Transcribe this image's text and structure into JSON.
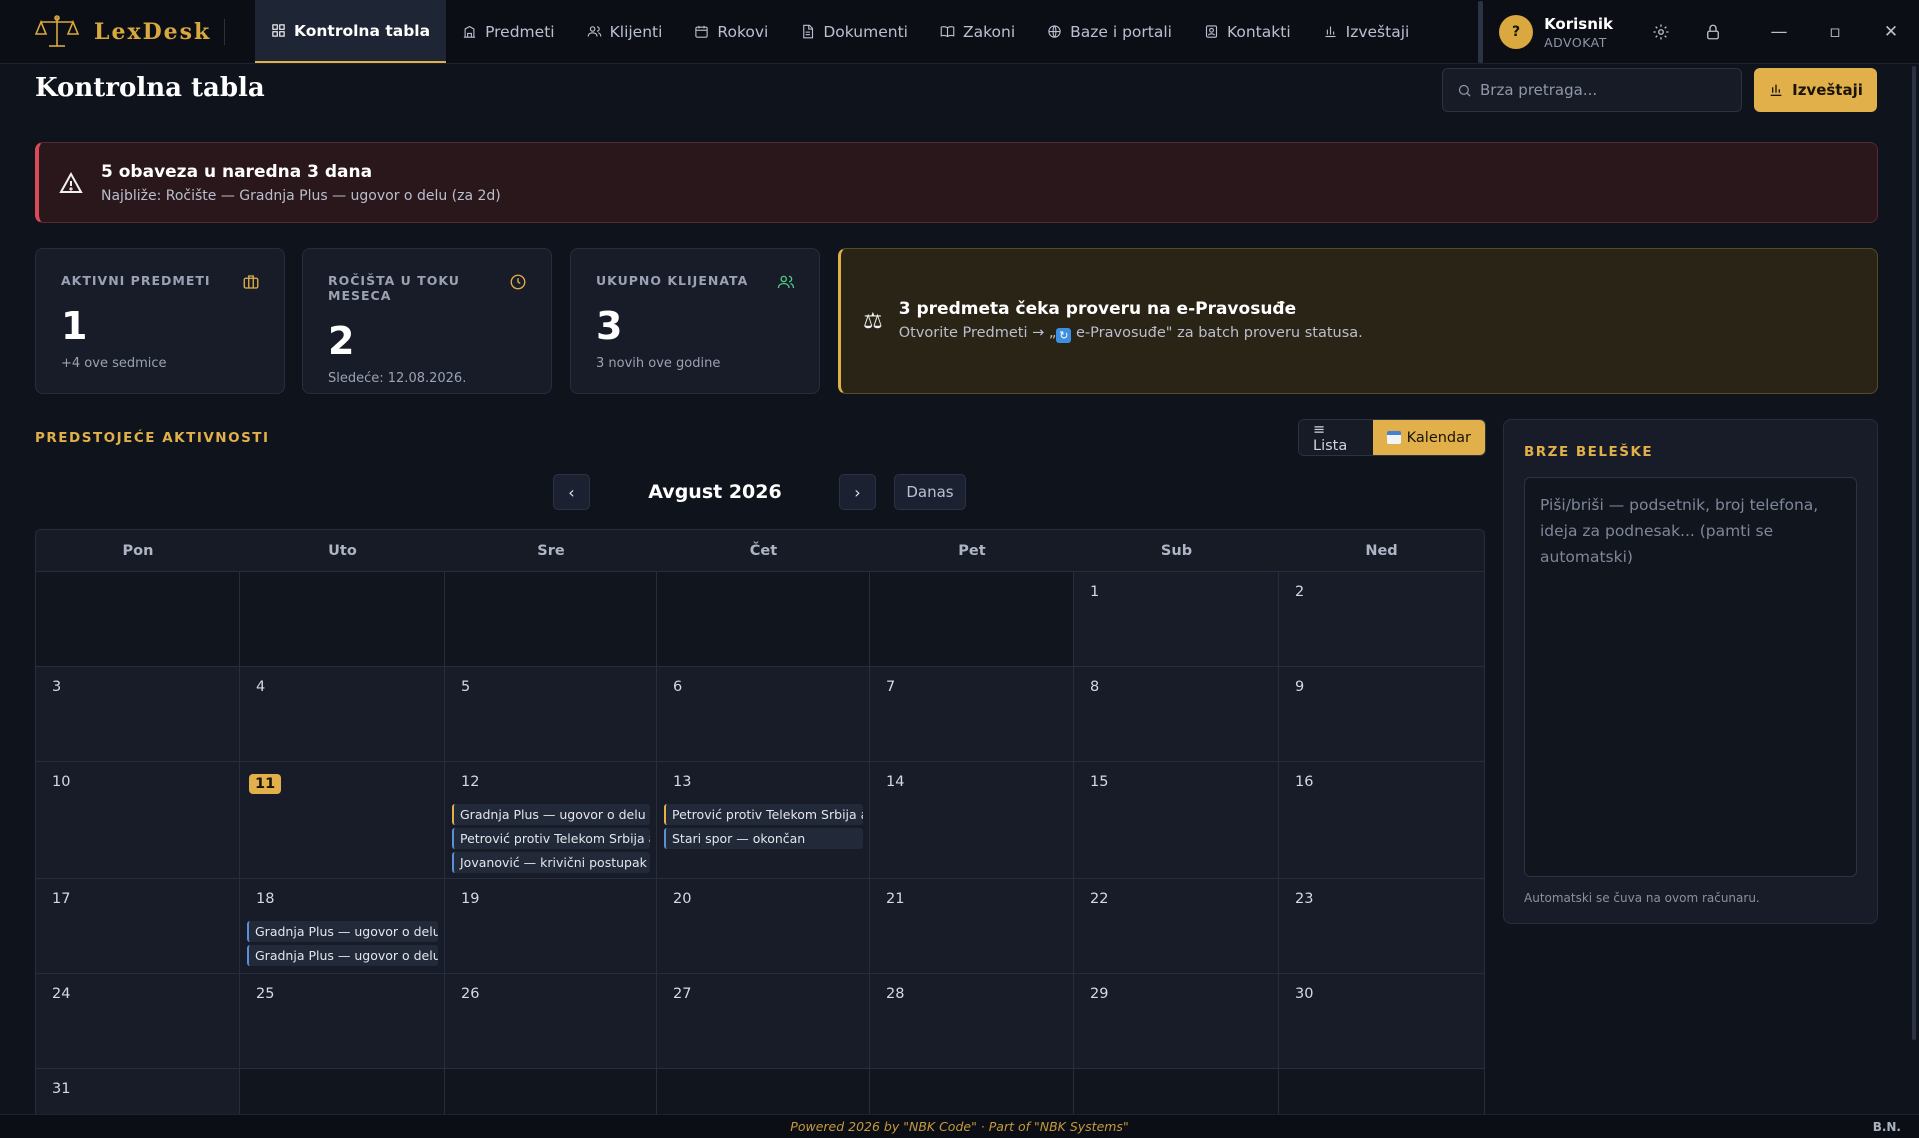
{
  "app": {
    "name": "LexDesk"
  },
  "nav": [
    {
      "label": "Kontrolna tabla",
      "icon": "dashboard-icon",
      "active": true
    },
    {
      "label": "Predmeti",
      "icon": "building-icon"
    },
    {
      "label": "Klijenti",
      "icon": "users-icon"
    },
    {
      "label": "Rokovi",
      "icon": "calendar-icon"
    },
    {
      "label": "Dokumenti",
      "icon": "document-icon"
    },
    {
      "label": "Zakoni",
      "icon": "book-icon"
    },
    {
      "label": "Baze i portali",
      "icon": "globe-icon"
    },
    {
      "label": "Kontakti",
      "icon": "contact-icon"
    },
    {
      "label": "Izveštaji",
      "icon": "bar-chart-icon"
    }
  ],
  "user": {
    "initial": "?",
    "name": "Korisnik",
    "role": "ADVOKAT"
  },
  "window_controls": {
    "minimize": "—",
    "maximize": "▫",
    "close": "✕"
  },
  "page": {
    "title": "Kontrolna tabla"
  },
  "search": {
    "placeholder": "Brza pretraga..."
  },
  "reports_button": {
    "label": "Izveštaji"
  },
  "alert": {
    "title": "5 obaveza u naredna 3 dana",
    "detail": "Najbliže: Ročište — Gradnja Plus — ugovor o delu (za 2d)"
  },
  "stats": [
    {
      "label": "AKTIVNI PREDMETI",
      "value": "1",
      "sub": "+4 ove sedmice",
      "icon": "briefcase-icon",
      "color": "#e1b04a"
    },
    {
      "label": "ROČIŠTA U TOKU MESECA",
      "value": "2",
      "sub": "Sledeće: 12.08.2026.",
      "icon": "clock-icon",
      "color": "#e1b04a"
    },
    {
      "label": "UKUPNO KLIJENATA",
      "value": "3",
      "sub": "3 novih ove godine",
      "icon": "users-icon",
      "color": "#4fc98a"
    }
  ],
  "notice": {
    "title": "3 predmeta čeka proveru na e-Pravosuđe",
    "detail_pre": "Otvorite Predmeti → „",
    "detail_post": " e-Pravosuđe\" za batch proveru statusa."
  },
  "activities": {
    "label": "PREDSTOJEĆE AKTIVNOSTI"
  },
  "view_toggle": {
    "list": "≡ Lista",
    "calendar": "Kalendar",
    "selected": "calendar"
  },
  "calendar": {
    "month_label": "Avgust 2026",
    "prev": "‹",
    "next": "›",
    "today_button": "Danas",
    "weekdays": [
      "Pon",
      "Uto",
      "Sre",
      "Čet",
      "Pet",
      "Sub",
      "Ned"
    ],
    "today": 11,
    "weeks": [
      [
        null,
        null,
        null,
        null,
        null,
        {
          "day": 1
        },
        {
          "day": 2
        }
      ],
      [
        {
          "day": 3
        },
        {
          "day": 4
        },
        {
          "day": 5
        },
        {
          "day": 6
        },
        {
          "day": 7
        },
        {
          "day": 8
        },
        {
          "day": 9
        }
      ],
      [
        {
          "day": 10
        },
        {
          "day": 11
        },
        {
          "day": 12,
          "events": [
            {
              "title": "Gradnja Plus — ugovor o delu",
              "kind": "gold"
            },
            {
              "title": "Petrović protiv Telekom Srbija a.d.",
              "kind": "blue"
            },
            {
              "title": "Jovanović — krivični postupak",
              "kind": "blue"
            }
          ]
        },
        {
          "day": 13,
          "events": [
            {
              "title": "Petrović protiv Telekom Srbija a.d.",
              "kind": "gold"
            },
            {
              "title": "Stari spor — okončan",
              "kind": "blue"
            }
          ]
        },
        {
          "day": 14
        },
        {
          "day": 15
        },
        {
          "day": 16
        }
      ],
      [
        {
          "day": 17
        },
        {
          "day": 18,
          "events": [
            {
              "title": "Gradnja Plus — ugovor o delu",
              "kind": "blue"
            },
            {
              "title": "Gradnja Plus — ugovor o delu",
              "kind": "blue"
            }
          ]
        },
        {
          "day": 19
        },
        {
          "day": 20
        },
        {
          "day": 21
        },
        {
          "day": 22
        },
        {
          "day": 23
        }
      ],
      [
        {
          "day": 24
        },
        {
          "day": 25
        },
        {
          "day": 26
        },
        {
          "day": 27
        },
        {
          "day": 28
        },
        {
          "day": 29
        },
        {
          "day": 30
        }
      ],
      [
        {
          "day": 31
        },
        null,
        null,
        null,
        null,
        null,
        null
      ]
    ]
  },
  "notes": {
    "label": "BRZE BELEŠKE",
    "placeholder": "Piši/briši — podsetnik, broj telefona, ideja za podnesak... (pamti se automatski)",
    "hint": "Automatski se čuva na ovom računaru."
  },
  "footer": {
    "text": "Powered 2026 by \"NBK Code\" · Part of \"NBK Systems\"",
    "initials": "B.N."
  }
}
